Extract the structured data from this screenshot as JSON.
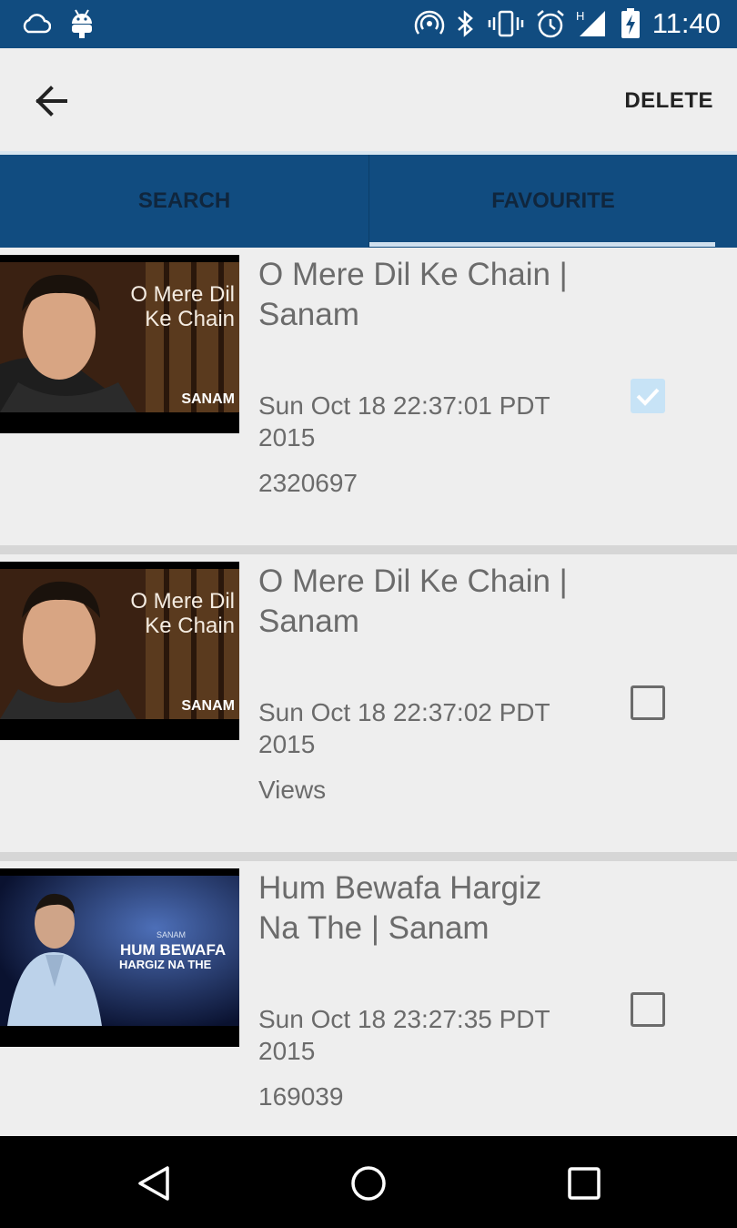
{
  "status_bar": {
    "time": "11:40",
    "icons": [
      "cloud-icon",
      "android-icon",
      "hotspot-icon",
      "bluetooth-icon",
      "vibrate-icon",
      "alarm-icon",
      "signal-icon",
      "battery-icon"
    ]
  },
  "toolbar": {
    "back_icon": "back-arrow-icon",
    "delete_label": "DELETE"
  },
  "tabs": [
    {
      "label": "SEARCH",
      "selected": false
    },
    {
      "label": "FAVOURITE",
      "selected": true
    }
  ],
  "items": [
    {
      "title_line1": "O Mere Dil Ke Chain |",
      "title_line2": "Sanam",
      "date_line1": "Sun Oct 18 22:37:01 PDT",
      "date_line2": "2015",
      "meta": "2320697",
      "checked": true,
      "thumb_text1": "O Mere Dil",
      "thumb_text2": "Ke Chain",
      "thumb_brand": "SANAM"
    },
    {
      "title_line1": "O Mere Dil Ke Chain |",
      "title_line2": "Sanam",
      "date_line1": "Sun Oct 18 22:37:02 PDT",
      "date_line2": "2015",
      "meta": "Views",
      "checked": false,
      "thumb_text1": "O Mere Dil",
      "thumb_text2": "Ke Chain",
      "thumb_brand": "SANAM"
    },
    {
      "title_line1": "Hum Bewafa Hargiz",
      "title_line2": "Na The | Sanam",
      "date_line1": "Sun Oct 18 23:27:35 PDT",
      "date_line2": "2015",
      "meta": "169039",
      "checked": false,
      "thumb_brand": "SANAM",
      "thumb_text1": "HUM BEWAFA",
      "thumb_text2": "HARGIZ NA THE"
    }
  ],
  "navbar": [
    "back-triangle-icon",
    "home-circle-icon",
    "recents-square-icon"
  ],
  "colors": {
    "primary": "#114c80",
    "background": "#eeeeee",
    "text": "#6b6b6b",
    "check_on": "#c7e3f6"
  }
}
